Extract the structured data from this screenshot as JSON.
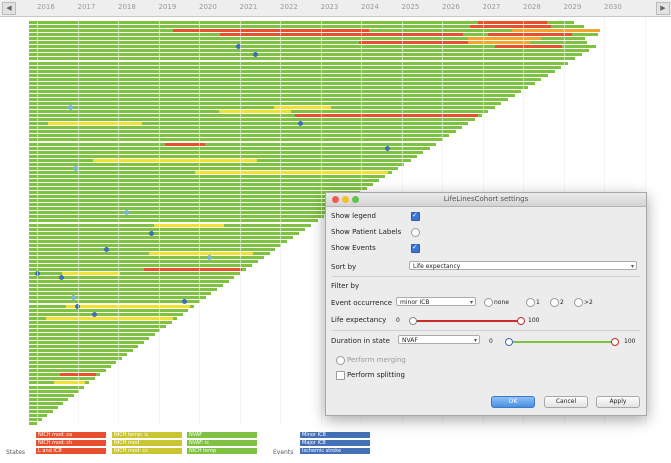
{
  "timeline": {
    "years": [
      "2016",
      "2017",
      "2018",
      "2019",
      "2020",
      "2021",
      "2022",
      "2023",
      "2024",
      "2025",
      "2026",
      "2027",
      "2028",
      "2029",
      "2030"
    ],
    "scroll_left": "◀",
    "scroll_right": "▶"
  },
  "colors": {
    "green": "#7fc241",
    "yellow": "#f0e032",
    "red": "#e84f2c",
    "orange": "#f2a42c",
    "dot_blue": "#3d6fb3",
    "dot_light": "#78b4dc"
  },
  "legend": {
    "states_label": "States",
    "events_label": "Events",
    "items": [
      {
        "label": "NICH mod: ca",
        "color": "#e84f2c"
      },
      {
        "label": "NICH mod: ch",
        "color": "#e84f2c"
      },
      {
        "label": "L and ICB",
        "color": "#e84f2c"
      },
      {
        "label": "NICH temp: ic",
        "color": "#c9c631"
      },
      {
        "label": "NICH mod",
        "color": "#c9c631"
      },
      {
        "label": "NICH mod: cs",
        "color": "#c9c631"
      },
      {
        "label": "NVAF",
        "color": "#7fc241"
      },
      {
        "label": "NVAF: ic",
        "color": "#7fc241"
      },
      {
        "label": "NICH temp",
        "color": "#7fc241"
      },
      {
        "label": "Minor ICB",
        "color": "#4470b8"
      },
      {
        "label": "Major ICB",
        "color": "#4470b8"
      },
      {
        "label": "Ischemic stroke",
        "color": "#4470b8"
      }
    ]
  },
  "dialog": {
    "title": "LifeLinesCohort settings",
    "show_legend_label": "Show legend",
    "show_legend_checked": true,
    "show_patient_labels_label": "Show Patient Labels",
    "show_patient_labels_checked": false,
    "show_events_label": "Show Events",
    "show_events_checked": true,
    "sort_by_label": "Sort by",
    "sort_by_value": "Life expectancy",
    "filter_by_label": "Filter by",
    "event_occurrence_label": "Event occurrence",
    "event_occurrence_value": "minor ICB",
    "radio_options": [
      "none",
      "1",
      "2",
      ">2"
    ],
    "life_expectancy_label": "Life expectancy",
    "life_expectancy_min": "0",
    "life_expectancy_max": "100",
    "life_expectancy_range": [
      0,
      100
    ],
    "duration_label": "Duration in state",
    "duration_value": "NVAF",
    "duration_min": "0",
    "duration_max": "100",
    "duration_range": [
      0,
      100
    ],
    "perform_merging_label": "Perform merging",
    "perform_splitting_label": "Perform splitting",
    "ok_label": "OK",
    "cancel_label": "Cancel",
    "apply_label": "Apply"
  }
}
